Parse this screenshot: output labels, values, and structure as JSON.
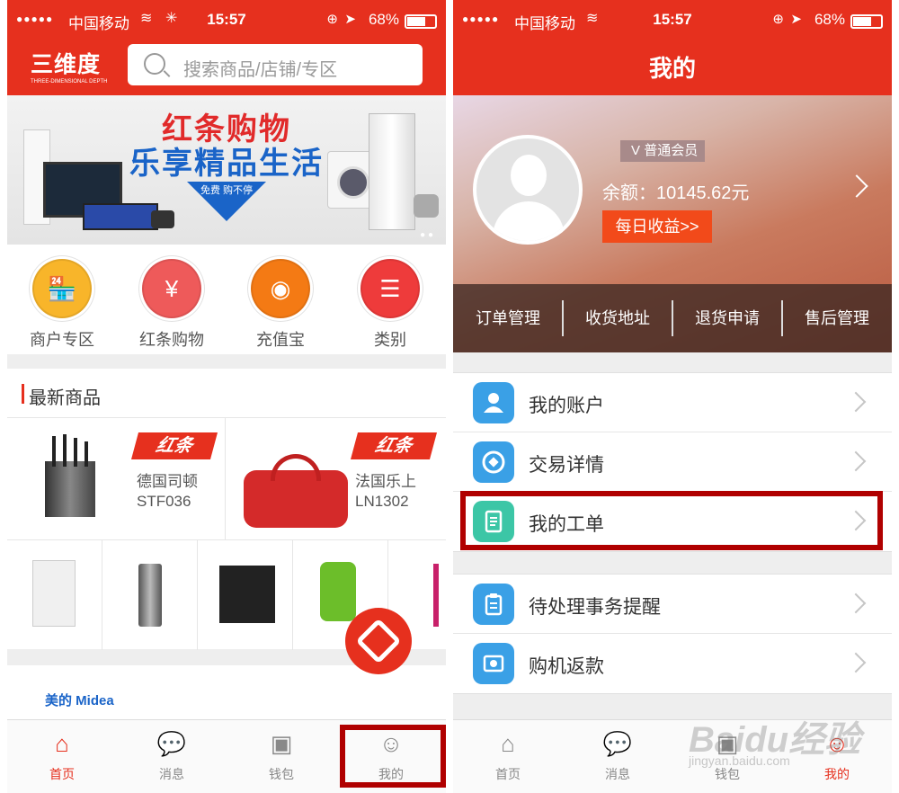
{
  "status": {
    "carrier": "中国移动",
    "time": "15:57",
    "battery": "68%"
  },
  "left": {
    "logo": {
      "cn": "三维度",
      "en": "THREE-DIMENSIONAL DEPTH"
    },
    "search_placeholder": "搜索商品/店铺/专区",
    "banner": {
      "line1": "红条购物",
      "line2": "乐享精品生活",
      "badge": "免费 购不停"
    },
    "quick": [
      {
        "label": "商户专区",
        "color": "#f8b52a",
        "icon": "store-icon"
      },
      {
        "label": "红条购物",
        "color": "#ee5a5a",
        "icon": "yen-icon"
      },
      {
        "label": "充值宝",
        "color": "#f47a14",
        "icon": "piggy-bank-icon"
      },
      {
        "label": "类别",
        "color": "#ee3b3b",
        "icon": "list-icon"
      }
    ],
    "section_title": "最新商品",
    "products": [
      {
        "tag": "红条",
        "name1": "德国司顿",
        "name2": "STF036"
      },
      {
        "tag": "红条",
        "name1": "法国乐上",
        "name2": "LN1302"
      }
    ],
    "brand": "美的 Midea",
    "tabs": [
      "首页",
      "消息",
      "钱包",
      "我的"
    ]
  },
  "right": {
    "title": "我的",
    "member": "普通会员",
    "balance": "余额：10145.62元",
    "daily": "每日收益>>",
    "orders": [
      "订单管理",
      "收货地址",
      "退货申请",
      "售后管理"
    ],
    "menu1": [
      {
        "label": "我的账户",
        "color": "#3aa0e6",
        "icon": "user-check-icon"
      },
      {
        "label": "交易详情",
        "color": "#3aa0e6",
        "icon": "target-icon"
      },
      {
        "label": "我的工单",
        "color": "#3cc6a6",
        "icon": "document-icon"
      }
    ],
    "menu2": [
      {
        "label": "待处理事务提醒",
        "color": "#3aa0e6",
        "icon": "clipboard-icon"
      },
      {
        "label": "购机返款",
        "color": "#3aa0e6",
        "icon": "refund-icon"
      }
    ],
    "tabs": [
      "首页",
      "消息",
      "钱包",
      "我的"
    ],
    "watermark": "Baidu经验",
    "watermark_url": "jingyan.baidu.com"
  }
}
